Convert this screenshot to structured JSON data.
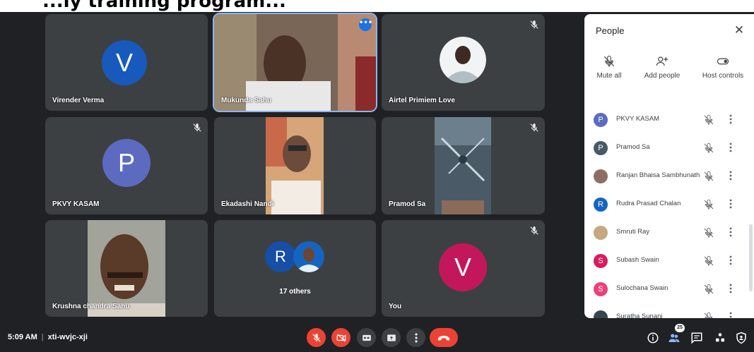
{
  "banner_text": "...ly training program...",
  "tiles": {
    "virender": {
      "name": "Virender Verma",
      "initial": "V",
      "color": "#185abc"
    },
    "mukunda": {
      "name": "Mukunda Sahu"
    },
    "airtel": {
      "name": "Airtel Primiem Love"
    },
    "pkvy": {
      "name": "PKVY KASAM",
      "initial": "P",
      "color": "#5c6bc0"
    },
    "ekadashi": {
      "name": "Ekadashi Nandi"
    },
    "pramod": {
      "name": "Pramod Sa"
    },
    "krushna": {
      "name": "Krushna chandra Sahu"
    },
    "others": {
      "label": "17 others",
      "initial": "R",
      "color": "#174ea6"
    },
    "you": {
      "name": "You",
      "initial": "V",
      "color": "#c2185b"
    }
  },
  "panel": {
    "title": "People",
    "controls": {
      "mute_all": "Mute all",
      "add_people": "Add people",
      "host_controls": "Host controls"
    },
    "participants": [
      {
        "name": "PKVY KASAM",
        "initial": "P",
        "color": "#5c6bc0"
      },
      {
        "name": "Pramod Sa",
        "initial": "P",
        "color": "#455a64"
      },
      {
        "name": "Ranjan Bhaisa Sambhunath",
        "initial": "",
        "color": "#8d6e63"
      },
      {
        "name": "Rudra Prasad Chalan",
        "initial": "R",
        "color": "#1565c0"
      },
      {
        "name": "Smruti Ray",
        "initial": "",
        "color": "#c5a880"
      },
      {
        "name": "Subash Swain",
        "initial": "S",
        "color": "#d81b60"
      },
      {
        "name": "Sulochana Swain",
        "initial": "S",
        "color": "#ec407a"
      },
      {
        "name": "Suratha Sunani",
        "initial": "",
        "color": "#37474f"
      }
    ]
  },
  "bottom": {
    "time": "5:09 AM",
    "meeting_code": "xti-wvjc-xji",
    "people_count": "25"
  },
  "colors": {
    "background": "#202124",
    "tile": "#3c4043",
    "danger": "#ea4335",
    "accent": "#1a73e8"
  }
}
